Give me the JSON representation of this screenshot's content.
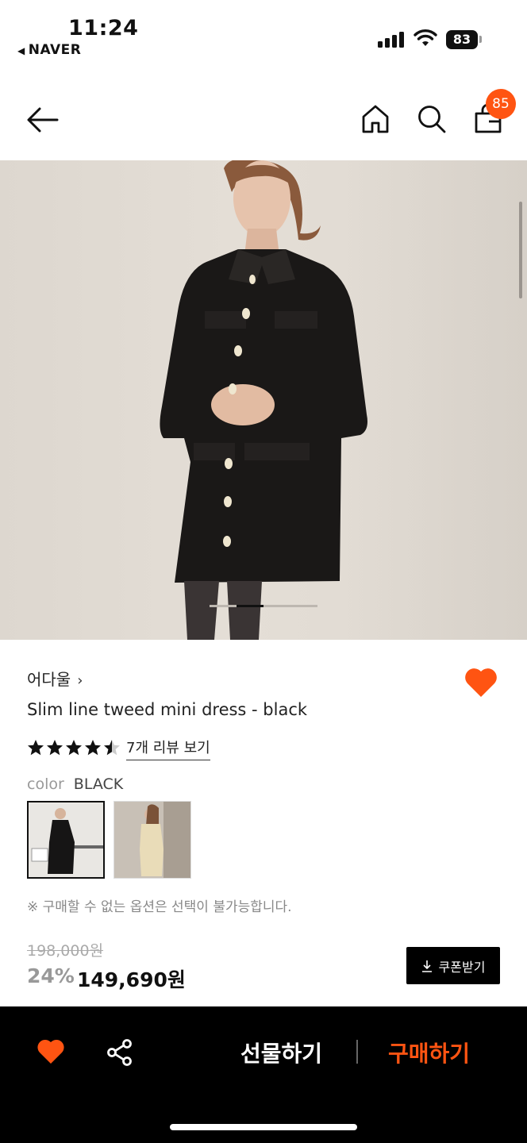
{
  "status_bar": {
    "time": "11:24",
    "back_app": "NAVER",
    "battery": "83"
  },
  "nav": {
    "back_icon": "arrow-left-icon",
    "home_icon": "home-icon",
    "search_icon": "search-icon",
    "cart_icon": "shopping-bag-icon",
    "cart_badge": "85"
  },
  "gallery": {
    "image_alt": "product photo",
    "page_count": 3,
    "current_page": 2
  },
  "product": {
    "brand": "어다울",
    "brand_chevron": "›",
    "name": "Slim line tweed mini dress - black",
    "rating": 4.5,
    "review_link": "7개 리뷰 보기",
    "color_label": "color",
    "color_value": "BLACK",
    "swatches": [
      {
        "name": "black",
        "selected": true
      },
      {
        "name": "beige",
        "selected": false
      }
    ],
    "notice": "※ 구매할 수 없는 옵션은 선택이 불가능합니다.",
    "original_price": "198,000원",
    "discount": "24%",
    "sale_price": "149,690원",
    "coupon_button": "쿠폰받기"
  },
  "bottom_bar": {
    "gift_button": "선물하기",
    "buy_button": "구매하기"
  },
  "colors": {
    "accent": "#ff5412",
    "black": "#000000"
  }
}
